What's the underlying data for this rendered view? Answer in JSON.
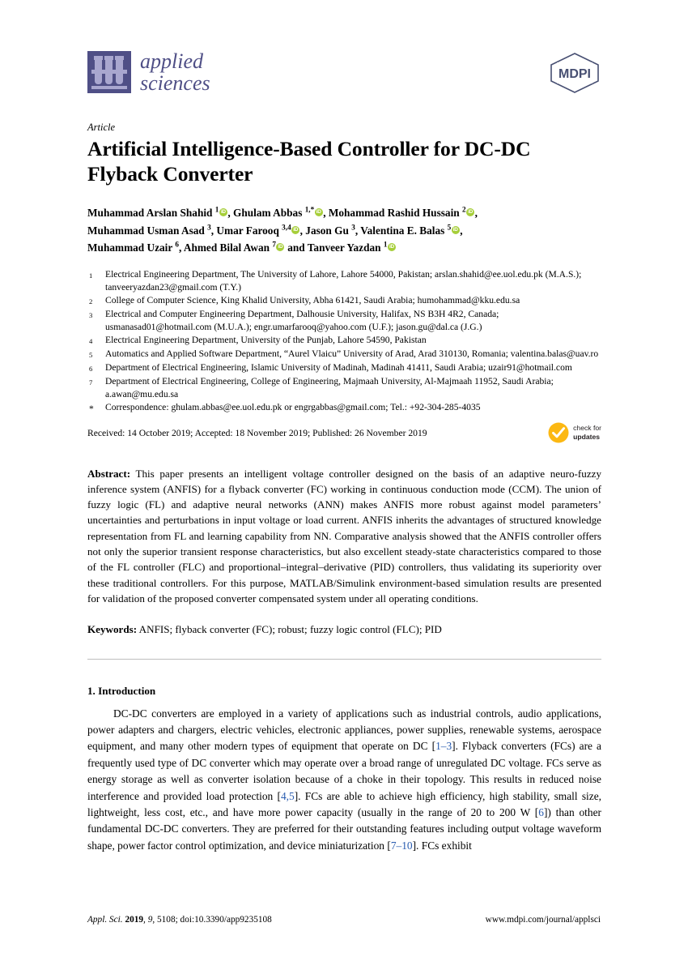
{
  "journal": {
    "name_line1": "applied",
    "name_line2": "sciences",
    "publisher": "MDPI",
    "logo_color": "#4f4f86",
    "tube_color": "#a9a7cf"
  },
  "article": {
    "type": "Article",
    "title": "Artificial Intelligence-Based Controller for DC-DC Flyback Converter"
  },
  "authors": {
    "line1": "Muhammad Arslan Shahid ",
    "line1_sup1": "1",
    "line1_b": ", Ghulam Abbas ",
    "line1_sup2": "1,*",
    "line1_c": ", Mohammad Rashid Hussain ",
    "line1_sup3": "2",
    "line1_end": ",",
    "line2_a": "Muhammad Usman Asad ",
    "line2_sup1": "3",
    "line2_b": ", Umar Farooq ",
    "line2_sup2": "3,4",
    "line2_c": ", Jason Gu ",
    "line2_sup3": "3",
    "line2_d": ", Valentina E. Balas ",
    "line2_sup4": "5",
    "line2_end": ",",
    "line3_a": "Muhammad Uzair ",
    "line3_sup1": "6",
    "line3_b": ", Ahmed Bilal Awan ",
    "line3_sup2": "7",
    "line3_c": " and Tanveer Yazdan ",
    "line3_sup3": "1",
    "orcid_label": "iD",
    "orcid_color": "#a6ce39"
  },
  "affiliations": [
    {
      "num": "1",
      "text": "Electrical Engineering Department, The University of Lahore, Lahore 54000, Pakistan; arslan.shahid@ee.uol.edu.pk (M.A.S.); tanveeryazdan23@gmail.com (T.Y.)"
    },
    {
      "num": "2",
      "text": "College of Computer Science, King Khalid University, Abha 61421, Saudi Arabia; humohammad@kku.edu.sa"
    },
    {
      "num": "3",
      "text": "Electrical and Computer Engineering Department, Dalhousie University, Halifax, NS B3H 4R2, Canada; usmanasad01@hotmail.com (M.U.A.); engr.umarfarooq@yahoo.com (U.F.); jason.gu@dal.ca (J.G.)"
    },
    {
      "num": "4",
      "text": "Electrical Engineering Department, University of the Punjab, Lahore 54590, Pakistan"
    },
    {
      "num": "5",
      "text": "Automatics and Applied Software Department, “Aurel Vlaicu” University of Arad, Arad 310130, Romania; valentina.balas@uav.ro"
    },
    {
      "num": "6",
      "text": "Department of Electrical Engineering, Islamic University of Madinah, Madinah 41411, Saudi Arabia; uzair91@hotmail.com"
    },
    {
      "num": "7",
      "text": "Department of Electrical Engineering, College of Engineering, Majmaah University, Al-Majmaah 11952, Saudi Arabia; a.awan@mu.edu.sa"
    },
    {
      "num": "*",
      "text": "Correspondence: ghulam.abbas@ee.uol.edu.pk or engrgabbas@gmail.com; Tel.: +92-304-285-4035"
    }
  ],
  "dates": "Received: 14 October 2019; Accepted: 18 November 2019; Published: 26 November 2019",
  "check_for_updates": {
    "line1": "check for",
    "line2": "updates",
    "badge_color": "#fcb813"
  },
  "abstract": {
    "label": "Abstract:",
    "text": " This paper presents an intelligent voltage controller designed on the basis of an adaptive neuro-fuzzy inference system (ANFIS) for a flyback converter (FC) working in continuous conduction mode (CCM). The union of fuzzy logic (FL) and adaptive neural networks (ANN) makes ANFIS more robust against model parameters’ uncertainties and perturbations in input voltage or load current. ANFIS inherits the advantages of structured knowledge representation from FL and learning capability from NN. Comparative analysis showed that the ANFIS controller offers not only the superior transient response characteristics, but also excellent steady-state characteristics compared to those of the FL controller (FLC) and proportional–integral–derivative (PID) controllers, thus validating its superiority over these traditional controllers. For this purpose, MATLAB/Simulink environment-based simulation results are presented for validation of the proposed converter compensated system under all operating conditions."
  },
  "keywords": {
    "label": "Keywords:",
    "text": " ANFIS; flyback converter (FC); robust; fuzzy logic control (FLC); PID"
  },
  "section": {
    "heading": "1. Introduction",
    "par1_a": "DC-DC converters are employed in a variety of applications such as industrial controls, audio applications, power adapters and chargers, electric vehicles, electronic appliances, power supplies, renewable systems, aerospace equipment, and many other modern types of equipment that operate on DC [",
    "cite1": "1–3",
    "par1_b": "]. Flyback converters (FCs) are a frequently used type of DC converter which may operate over a broad range of unregulated DC voltage. FCs serve as energy storage as well as converter isolation because of a choke in their topology. This results in reduced noise interference and provided load protection [",
    "cite2": "4,5",
    "par1_c": "]. FCs are able to achieve high efficiency, high stability, small size, lightweight, less cost, etc., and have more power capacity (usually in the range of 20 to 200 W [",
    "cite3": "6",
    "par1_d": "]) than other fundamental DC-DC converters. They are preferred for their outstanding features including output voltage waveform shape, power factor control optimization, and device miniaturization [",
    "cite4": "7–10",
    "par1_e": "]. FCs exhibit",
    "cite_color": "#2a5db0"
  },
  "footer": {
    "journal_abbrev": "Appl. Sci.",
    "year": "2019",
    "volume": ", 9",
    "article_no": ", 5108; doi:10.3390/app9235108",
    "url": "www.mdpi.com/journal/applsci"
  }
}
